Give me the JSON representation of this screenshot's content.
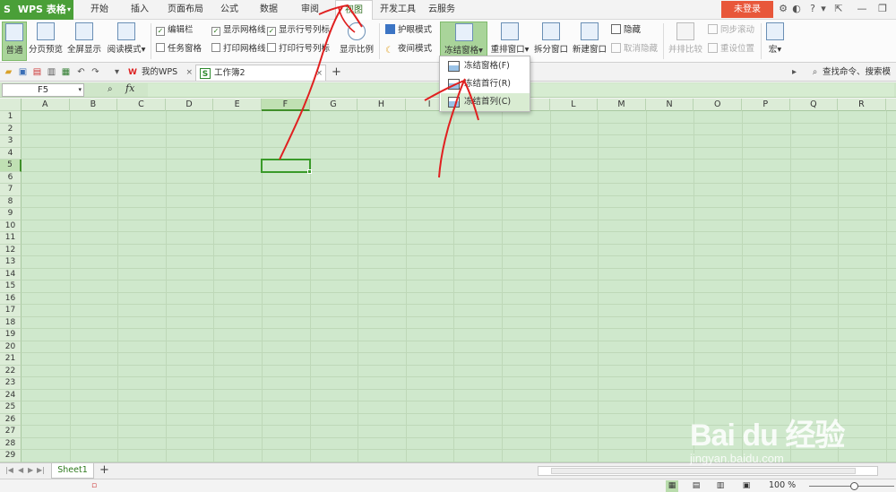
{
  "app": {
    "name": "WPS 表格",
    "logo": "S"
  },
  "menu_tabs": [
    "开始",
    "插入",
    "页面布局",
    "公式",
    "数据",
    "审阅",
    "视图",
    "开发工具",
    "云服务"
  ],
  "active_tab": "视图",
  "login_button": "未登录",
  "ribbon": {
    "normal": "普通",
    "page_break_preview": "分页预览",
    "full_screen": "全屏显示",
    "reading_mode": "阅读模式",
    "edit_bar": "编辑栏",
    "task_pane": "任务窗格",
    "show_gridlines": "显示网格线",
    "print_gridlines": "打印网格线",
    "show_headings": "显示行号列标",
    "print_headings": "打印行号列标",
    "zoom": "显示比例",
    "eye_protection": "护眼模式",
    "night_mode": "夜间模式",
    "freeze_panes": "冻结窗格",
    "arrange": "重排窗口",
    "split": "拆分窗口",
    "new_window": "新建窗口",
    "hide": "隐藏",
    "unhide": "取消隐藏",
    "side_by_side": "并排比较",
    "sync_scroll": "同步滚动",
    "reset_position": "重设位置",
    "macro": "宏"
  },
  "freeze_menu": {
    "items": [
      "冻结窗格(F)",
      "冻结首行(R)",
      "冻结首列(C)"
    ]
  },
  "quickbar": {
    "tabs": [
      "我的WPS",
      "工作簿2"
    ],
    "search_text": "查找命令、搜索模"
  },
  "formula_bar": {
    "name_box": "F5",
    "fx": "fx",
    "value": ""
  },
  "grid": {
    "columns": [
      "A",
      "B",
      "C",
      "D",
      "E",
      "F",
      "G",
      "H",
      "I",
      "J",
      "K",
      "L",
      "M",
      "N",
      "O",
      "P",
      "Q",
      "R"
    ],
    "rows": [
      "1",
      "2",
      "3",
      "4",
      "5",
      "6",
      "7",
      "8",
      "9",
      "10",
      "11",
      "12",
      "13",
      "14",
      "15",
      "16",
      "17",
      "18",
      "19",
      "20",
      "21",
      "22",
      "23",
      "24",
      "25",
      "26",
      "27",
      "28",
      "29"
    ],
    "active_column": "F",
    "active_row": "5"
  },
  "sheet_tabs": [
    "Sheet1"
  ],
  "status": {
    "zoom": "100 %"
  },
  "watermark": {
    "main": "Bai du 经验",
    "sub": "jingyan.baidu.com"
  },
  "colors": {
    "brand": "#4a9f38",
    "login": "#e8573a",
    "sheet_bg": "#cfe8cc",
    "annotation": "#e02020"
  }
}
